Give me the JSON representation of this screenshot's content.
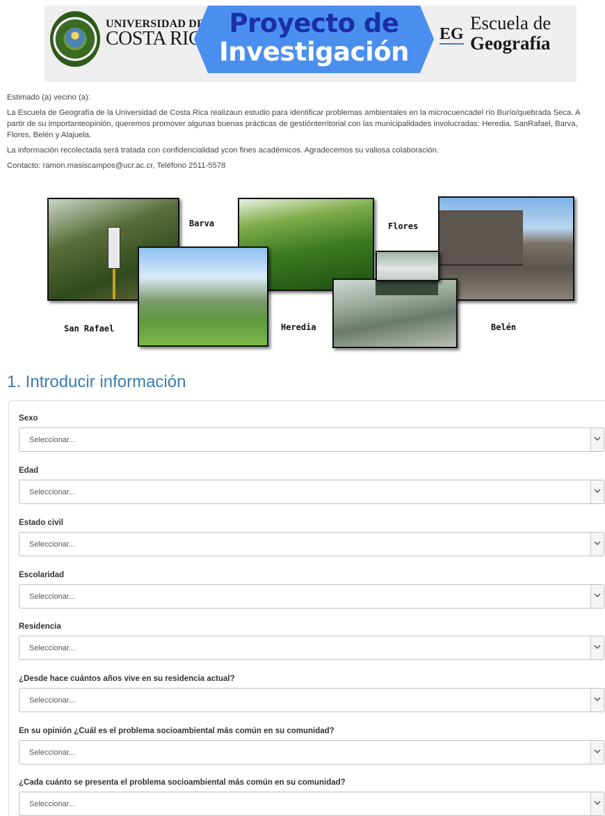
{
  "banner": {
    "ucr_line1": "UNIVERSIDAD DE",
    "ucr_line2": "COSTA RICA",
    "proyecto_line1": "Proyecto de",
    "proyecto_line2": "Investigación",
    "eg_mark": "EG",
    "escuela_line1": "Escuela de",
    "escuela_line2": "Geografía",
    "colors": {
      "proyecto_bg": "#4a8ff0",
      "proyecto_text": "#1a2fa8"
    }
  },
  "intro": {
    "greeting": "Estimado (a) vecino (a):",
    "paragraph1": "La Escuela de Geografía de la Universidad de Costa Rica realizaun estudio para identificar problemas ambientales en la microcuencadel río Burío/quebrada Seca. A partir de su importanteopinión, queremos promover algunas buenas prácticas de gestiónterritorial con las municipalidades involucradas: Heredia, SanRafael, Barva, Flores, Belén y Alajuela.",
    "paragraph2": "La información recolectada será tratada con confidencialidad ycon fines académicos. Agradecemos su valiosa colaboración.",
    "contact": "Contacto: ramon.masiscampos@ucr.ac.cr, Teléfono 2511-5578"
  },
  "collage": {
    "labels": {
      "barva": "Barva",
      "flores": "Flores",
      "san_rafael": "San Rafael",
      "heredia": "Heredia",
      "belen": "Belén"
    }
  },
  "form": {
    "section_title": "1. Introducir información",
    "fields": [
      {
        "label": "Sexo",
        "value": "Seleccionar..."
      },
      {
        "label": "Edad",
        "value": "Seleccionar..."
      },
      {
        "label": "Estado civil",
        "value": "Seleccionar..."
      },
      {
        "label": "Escolaridad",
        "value": "Seleccionar..."
      },
      {
        "label": "Residencia",
        "value": "Seleccionar..."
      },
      {
        "label": "¿Desde hace cuántos años vive en su residencia actual?",
        "value": "Seleccionar..."
      },
      {
        "label": "En su opinión ¿Cuál es el problema socioambiental más común en su comunidad?",
        "value": "Seleccionar..."
      },
      {
        "label": "¿Cada cuánto se presenta el problema socioambiental más común en su comunidad?",
        "value": "Seleccionar..."
      }
    ]
  }
}
